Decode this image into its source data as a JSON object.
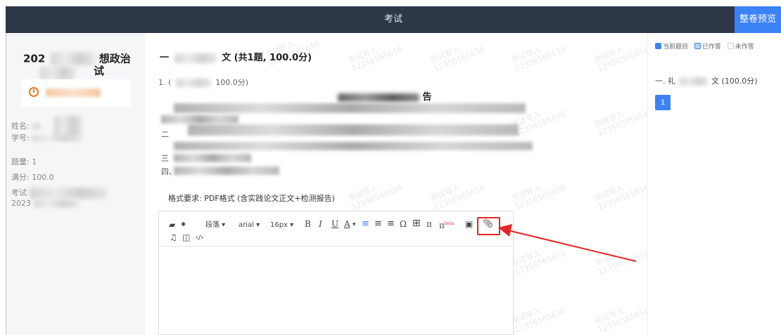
{
  "header": {
    "title": "考试",
    "preview_label": "整卷预览"
  },
  "left": {
    "exam_title_prefix": "202",
    "exam_title_suffix": "想政治",
    "exam_title_line2": "试",
    "name_label": "姓名:",
    "id_label": "学号:",
    "question_count": "题量: 1",
    "full_score": "满分: 100.0",
    "exam_time_label": "考试",
    "exam_time_year": "2023"
  },
  "main": {
    "section_title_prefix": "一",
    "section_title_suffix": "文 (共1题, 100.0分)",
    "question_prefix": "1. (",
    "question_suffix": "100.0分)",
    "heading_suffix": "告",
    "outline": [
      "二",
      "三",
      "四、"
    ],
    "format_requirement": "格式要求: PDF格式 (含实践论文正文+检测报告)"
  },
  "toolbar": {
    "paragraph": "段落",
    "font": "arial",
    "size": "16px",
    "bold": "B",
    "italic": "I",
    "underline": "U",
    "font_color": "A",
    "omega": "Ω",
    "pi": "π",
    "pi_beta": "π",
    "beta_sup": "beta",
    "code": "‹/›"
  },
  "watermark": {
    "text": "测试导入",
    "number": "12356565656"
  },
  "right": {
    "legend": {
      "current": "当前题目",
      "answered": "已作答",
      "unanswered": "未作答"
    },
    "section_prefix": "一. 礼",
    "section_suffix": "文 (100.0分)",
    "question_number": "1"
  },
  "colors": {
    "accent": "#3b82f6",
    "header_bg": "#2d3748",
    "highlight": "#e32626",
    "timer": "#f97316"
  }
}
